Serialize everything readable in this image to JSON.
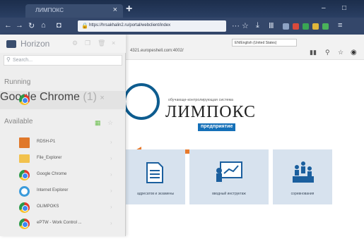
{
  "browser": {
    "tab_title": "ЛИМПОКС",
    "tab_close": "×",
    "new_tab": "+",
    "url": "https://hrsakhalin2.ru/portal/webclient/index",
    "url_tail": "··· ☆",
    "win_min": "–",
    "win_max": "□"
  },
  "remote_page": {
    "url": "4321.europeshell.com:4002/",
    "language": "EN/English (United States)",
    "logo": {
      "subtitle": "обучающе-контролирующая система",
      "name": "ЛИМПОКС",
      "badge": "предприятие"
    },
    "tiles": [
      {
        "label": "адресатов и экзамены"
      },
      {
        "label": "вводный инструктаж"
      },
      {
        "label": "соревнования"
      }
    ]
  },
  "horizon": {
    "title": "Horizon",
    "search_placeholder": "Search...",
    "running_label": "Running",
    "running_app": {
      "name": "Google Chrome",
      "badge": "(1)",
      "close": "×"
    },
    "available_label": "Available",
    "apps": [
      {
        "name": "RDSH-P1",
        "icon": "rdp-icon"
      },
      {
        "name": "File_Explorer",
        "icon": "folder-icon"
      },
      {
        "name": "Google Chrome",
        "icon": "chrome-icon"
      },
      {
        "name": "Internet Explorer",
        "icon": "ie-icon"
      },
      {
        "name": "OLIMPOKS",
        "icon": "chrome-icon"
      },
      {
        "name": "ePTW - Work Control ...",
        "icon": "chrome-icon"
      }
    ]
  },
  "colors": {
    "accent": "#1570b8",
    "arrow": "#e87a2c",
    "tile_bg": "#d7e2ee"
  }
}
